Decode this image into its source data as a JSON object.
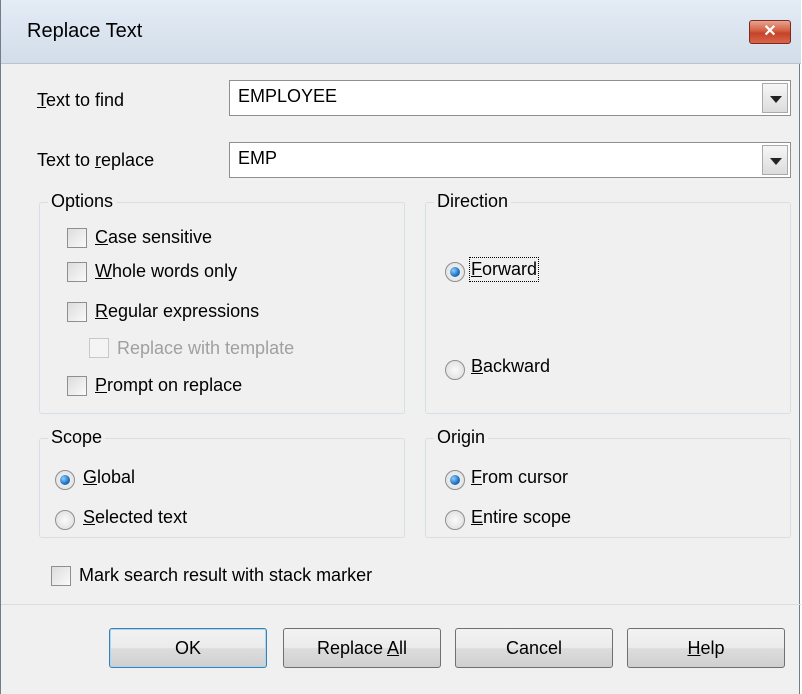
{
  "window": {
    "title": "Replace Text",
    "close_glyph": "✕"
  },
  "find": {
    "label_pre": "",
    "label_u": "T",
    "label_post": "ext to find",
    "value": "EMPLOYEE"
  },
  "replace": {
    "label_pre": "Text to ",
    "label_u": "r",
    "label_post": "eplace",
    "value": "EMP"
  },
  "options": {
    "caption": "Options",
    "case_u": "C",
    "case_rest": "ase sensitive",
    "whole_u": "W",
    "whole_rest": "hole words only",
    "regex_u": "R",
    "regex_rest": "egular expressions",
    "template": "Replace with template",
    "prompt_u": "P",
    "prompt_rest": "rompt on replace"
  },
  "direction": {
    "caption": "Direction",
    "forward_u": "F",
    "forward_rest": "orward",
    "backward_u": "B",
    "backward_rest": "ackward"
  },
  "scope": {
    "caption": "Scope",
    "global_u": "G",
    "global_rest": "lobal",
    "selected_u": "S",
    "selected_rest": "elected text"
  },
  "origin": {
    "caption": "Origin",
    "cursor_u": "F",
    "cursor_rest": "rom cursor",
    "entire_u": "E",
    "entire_rest": "ntire scope"
  },
  "mark": {
    "label": "Mark search result with stack marker"
  },
  "buttons": {
    "ok": "OK",
    "replace_all_pre": "Replace ",
    "replace_all_u": "A",
    "replace_all_post": "ll",
    "cancel": "Cancel",
    "help_u": "H",
    "help_rest": "elp"
  },
  "state": {
    "direction": "Forward",
    "scope": "Global",
    "origin": "From cursor",
    "case_sensitive": false,
    "whole_words": false,
    "regex": false,
    "replace_with_template": false,
    "prompt_on_replace": false,
    "mark_with_stack_marker": false
  },
  "colors": {
    "accent": "#1f6fc1",
    "close_button": "#c4442a"
  }
}
